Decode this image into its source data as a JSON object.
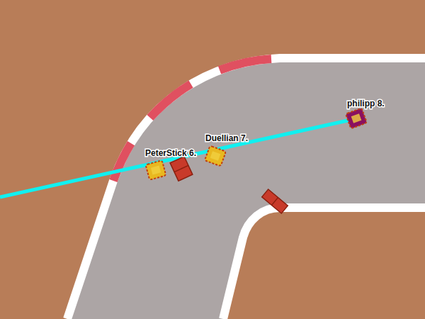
{
  "game": {
    "view": "top-down race track"
  },
  "players": [
    {
      "label": "PeterStick 6.",
      "color": "#e8b820"
    },
    {
      "label": "Duellian 7.",
      "color": "#e8b820"
    },
    {
      "label": "philipp 8.",
      "color": "#8a1060"
    }
  ]
}
